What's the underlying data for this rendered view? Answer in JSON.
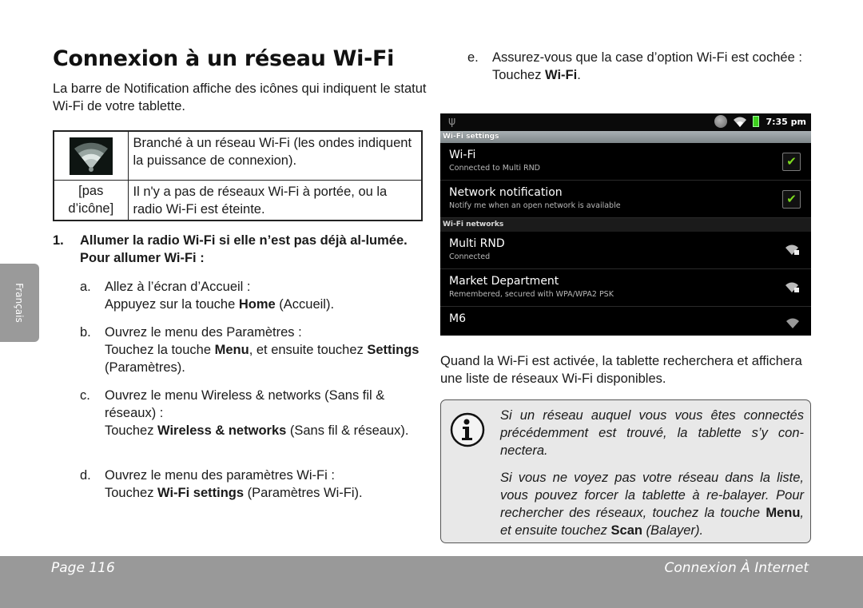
{
  "title": "Connexion à un réseau Wi-Fi",
  "intro": "La barre de Notification affiche des icônes qui indiquent le statut Wi-Fi de votre tablette.",
  "status_table": {
    "rows": [
      {
        "icon": "wifi-signal-icon",
        "description": "Branché à un réseau Wi-Fi (les ondes indiquent la puissance de connexion)."
      },
      {
        "icon_text": "[pas d’icône]",
        "description": "Il n'y a pas de réseaux Wi-Fi à portée, ou la radio Wi-Fi est éteinte."
      }
    ]
  },
  "step1": {
    "number": "1.",
    "text": "Allumer la radio Wi-Fi si elle n’est pas déjà al-lumée. Pour allumer Wi-Fi :"
  },
  "substeps": {
    "a": {
      "label": "a.",
      "line1": "Allez à l’écran d’Accueil :",
      "pre": "Appuyez sur la touche ",
      "bold": "Home",
      "post": " (Accueil)."
    },
    "b": {
      "label": "b.",
      "line1": "Ouvrez le menu des Paramètres :",
      "pre": "Touchez la touche ",
      "bold": "Menu",
      "mid": ", et ensuite touchez ",
      "bold2": "Settings",
      "post": " (Paramètres)."
    },
    "c": {
      "label": "c.",
      "line1": "Ouvrez le menu Wireless & networks (Sans fil & réseaux) :",
      "pre": "Touchez ",
      "bold": "Wireless & networks",
      "post": " (Sans fil & réseaux)."
    },
    "d": {
      "label": "d.",
      "line1": "Ouvrez le menu des paramètres Wi-Fi :",
      "pre": "Touchez ",
      "bold": "Wi-Fi settings",
      "post": " (Paramètres Wi-Fi)."
    },
    "e": {
      "label": "e.",
      "line1": "Assurez-vous que la case d’option Wi-Fi est cochée :",
      "pre": "Touchez ",
      "bold": "Wi-Fi",
      "post": "."
    }
  },
  "language_tab": "Français",
  "android": {
    "status_bar": {
      "usb_icon": "usb-icon",
      "time": "7:35 pm",
      "icons": [
        "sync-icon",
        "wifi-icon",
        "battery-charging-icon"
      ]
    },
    "header": "Wi-Fi settings",
    "settings": [
      {
        "title": "Wi-Fi",
        "subtitle": "Connected to Multi RND",
        "checked": true
      },
      {
        "title": "Network notification",
        "subtitle": "Notify me when an open network is available",
        "checked": true
      }
    ],
    "networks_header": "Wi-Fi networks",
    "networks": [
      {
        "name": "Multi RND",
        "status": "Connected",
        "secured": true
      },
      {
        "name": "Market Department",
        "status": "Remembered, secured with WPA/WPA2 PSK",
        "secured": true
      },
      {
        "name": "M6",
        "status": "",
        "secured": false
      }
    ]
  },
  "after_text": "Quand la Wi-Fi est activée, la tablette recherchera et affichera une liste de réseaux Wi-Fi disponibles.",
  "note": {
    "icon": "info-icon",
    "p1": "Si un réseau auquel vous vous êtes connectés précédemment est trouvé, la tablette s’y con-nectera.",
    "p2_pre": "Si vous ne voyez pas votre réseau dans la liste, vous pouvez forcer la tablette à re-balayer. Pour rechercher des réseaux, touchez la touche ",
    "p2_bold1": "Menu",
    "p2_mid": ", et ensuite touchez ",
    "p2_bold2": "Scan",
    "p2_post": " (Balayer)."
  },
  "footer": {
    "page": "Page 116",
    "section": "Connexion À Internet"
  }
}
